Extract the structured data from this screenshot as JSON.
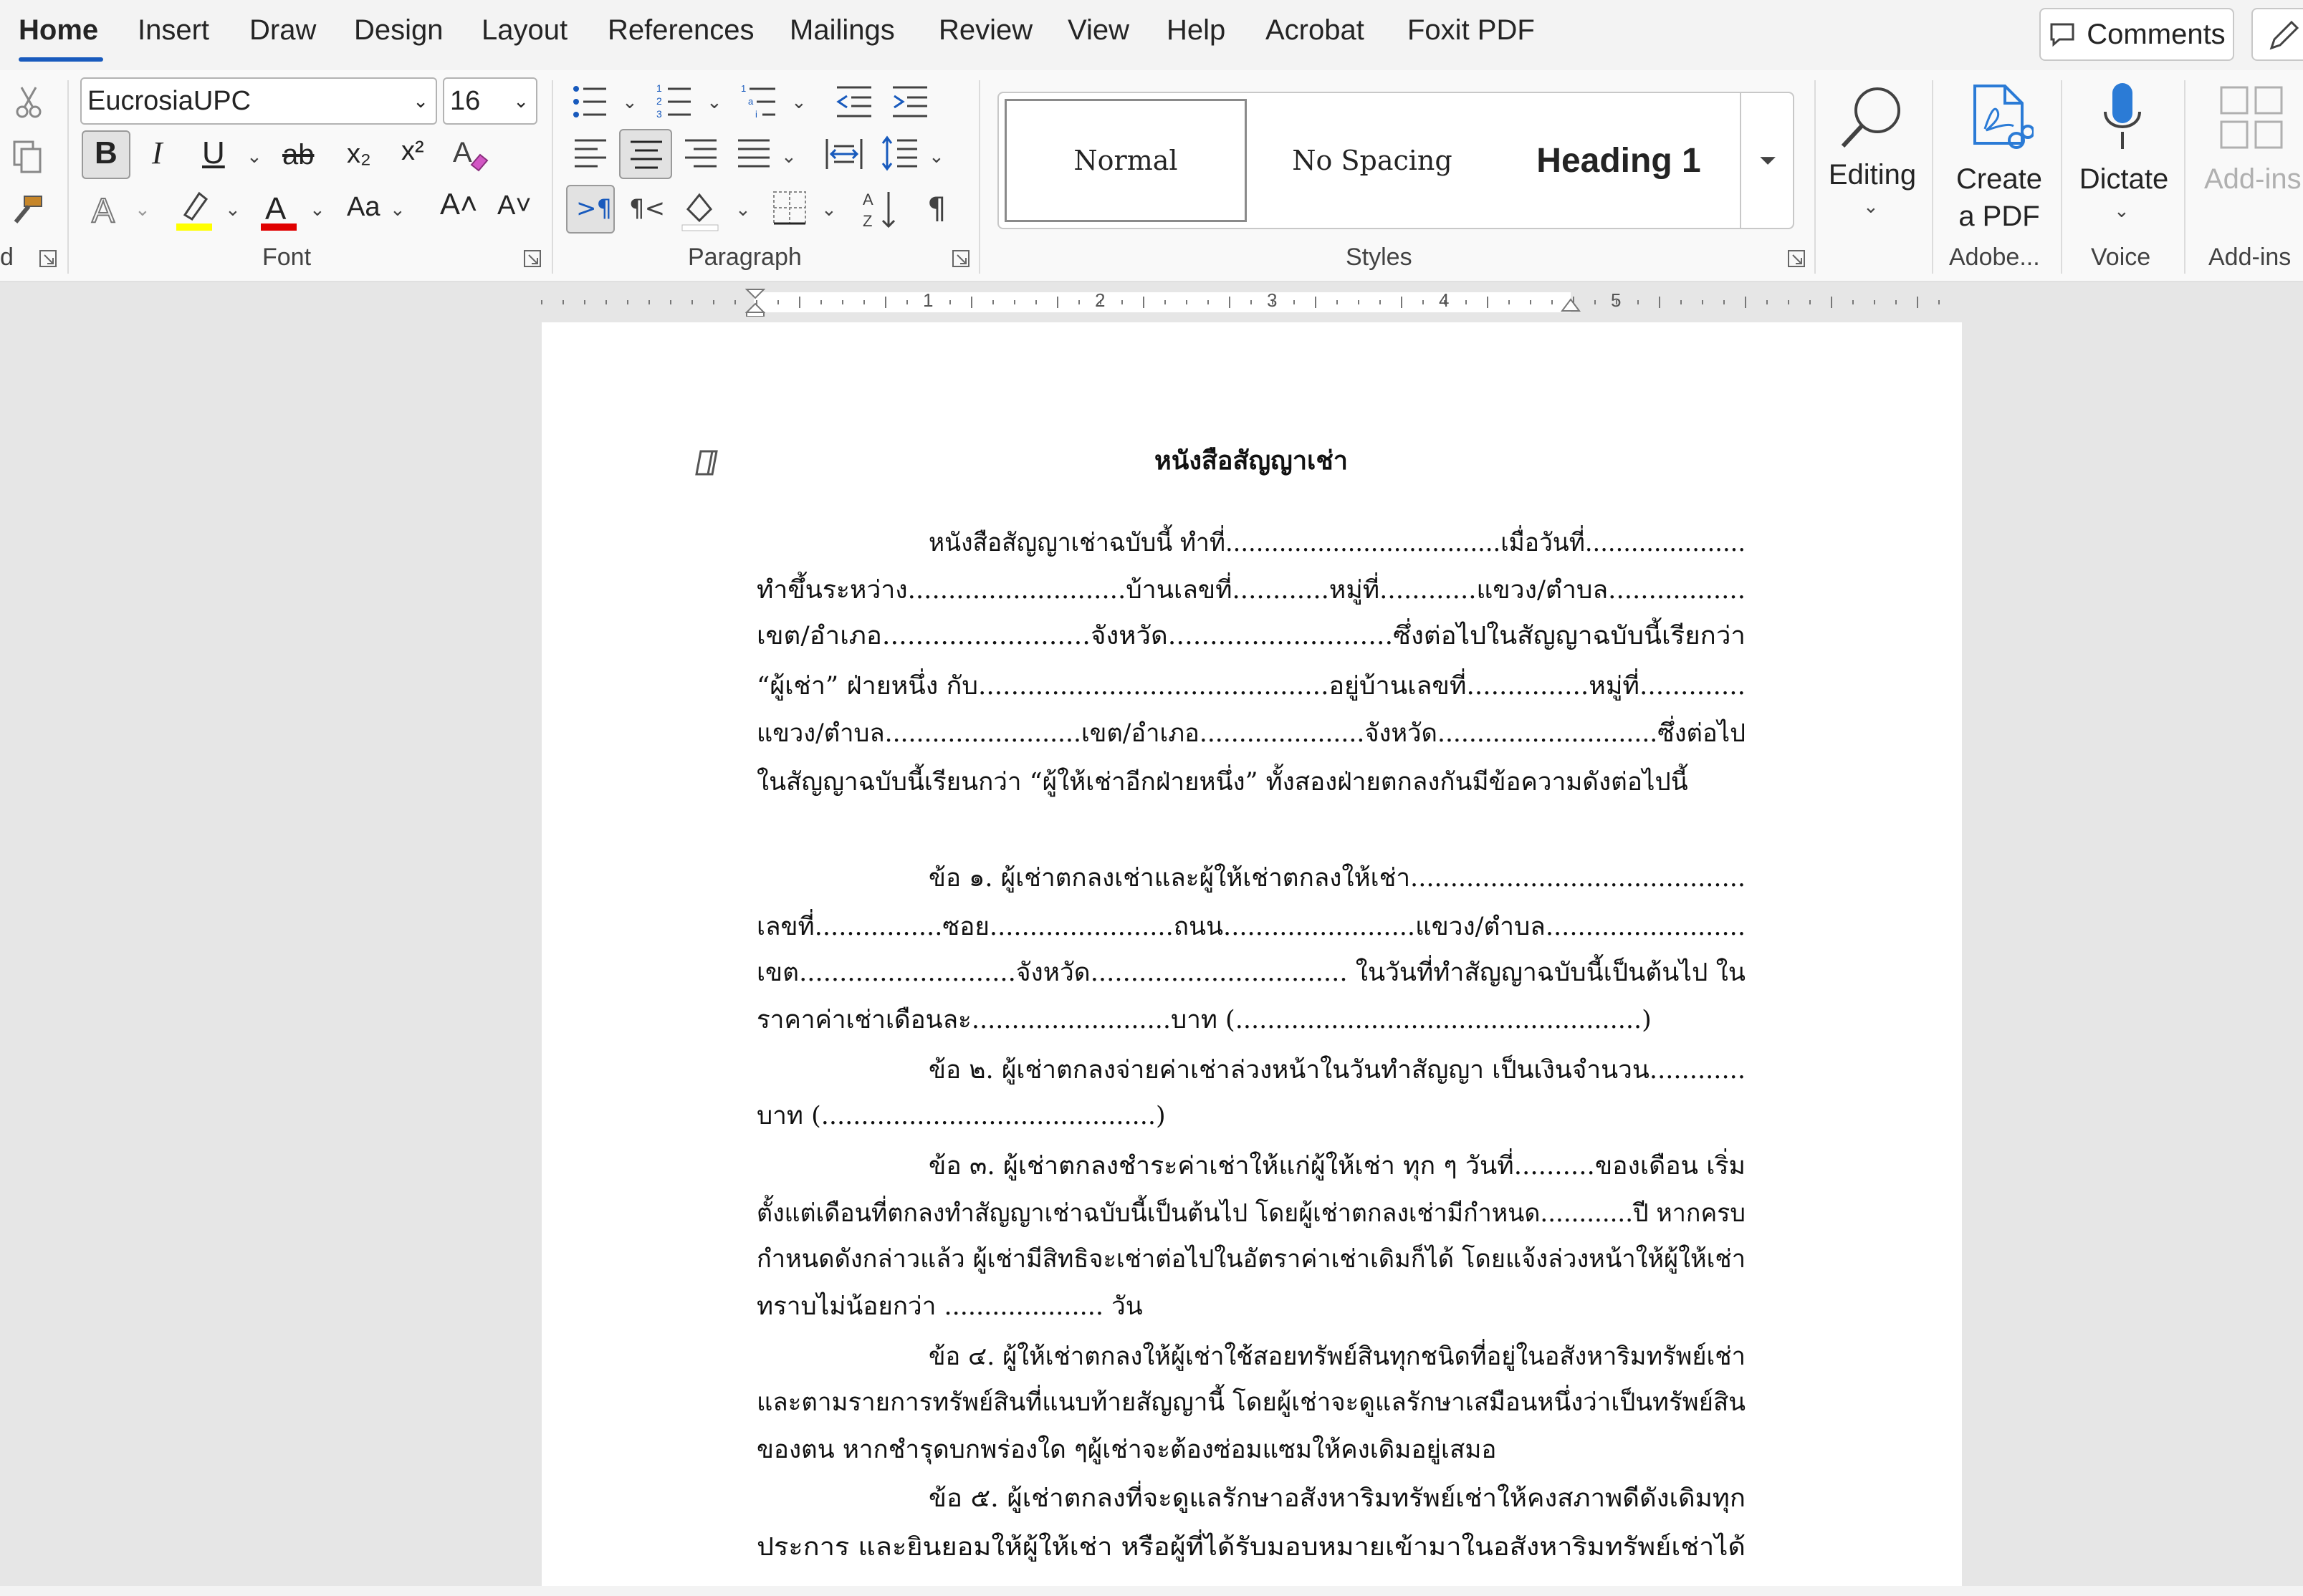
{
  "tabs": [
    "Home",
    "Insert",
    "Draw",
    "Design",
    "Layout",
    "References",
    "Mailings",
    "Review",
    "View",
    "Help",
    "Acrobat",
    "Foxit PDF"
  ],
  "active_tab": "Home",
  "comments_label": "Comments",
  "font": {
    "name": "EucrosiaUPC",
    "size": "16"
  },
  "groups": {
    "clipboard": "d",
    "font": "Font",
    "paragraph": "Paragraph",
    "styles": "Styles",
    "adobe": "Adobe...",
    "voice": "Voice",
    "addins": "Add-ins"
  },
  "styles": [
    "Normal",
    "No Spacing",
    "Heading 1"
  ],
  "buttons": {
    "editing": "Editing",
    "create_pdf_1": "Create",
    "create_pdf_2": "a PDF",
    "dictate": "Dictate",
    "addins": "Add-ins"
  },
  "format_glyphs": {
    "bold": "B",
    "italic": "I",
    "underline": "U",
    "strike": "ab",
    "subscript": "x₂",
    "superscript": "x²",
    "case": "Aa",
    "grow": "A˄",
    "shrink": "A˅"
  },
  "ruler_numbers": [
    "1",
    "2",
    "3",
    "4",
    "5"
  ],
  "colors": {
    "accent": "#185abd",
    "highlight": "#ffff00",
    "font_color": "#e00000",
    "dictate": "#2b7bd6"
  },
  "document": {
    "title": "หนังสือสัญญาเช่า",
    "lines": [
      "หนังสือสัญญาเช่าฉบับนี้ ทำที่....................................เมื่อวันที่.....................",
      "ทำขึ้นระหว่าง...........................บ้านเลขที่............หมู่ที่............แขวง/ตำบล.................",
      "เขต/อำเภอ.........................จังหวัด...........................ซึ่งต่อไปในสัญญาฉบับนี้เรียกว่า",
      "“ผู้เช่า” ฝ่ายหนึ่ง กับ...........................................อยู่บ้านเลขที่...............หมู่ที่.............",
      "แขวง/ตำบล.........................เขต/อำเภอ.....................จังหวัด............................ซึ่งต่อไป",
      "ในสัญญาฉบับนี้เรียนกว่า “ผู้ให้เช่าอีกฝ่ายหนึ่ง” ทั้งสองฝ่ายตกลงกันมีข้อความดังต่อไปนี้",
      "ข้อ ๑. ผู้เช่าตกลงเช่าและผู้ให้เช่าตกลงให้เช่า..........................................",
      "เลขที่................ซอย.......................ถนน........................แขวง/ตำบล.........................",
      "เขต...........................จังหวัด................................ ในวันที่ทำสัญญาฉบับนี้เป็นต้นไป ใน",
      "ราคาค่าเช่าเดือนละ.........................บาท (...................................................)",
      "ข้อ ๒. ผู้เช่าตกลงจ่ายค่าเช่าล่วงหน้าในวันทำสัญญา เป็นเงินจำนวน............",
      "บาท (..........................................)",
      "ข้อ ๓. ผู้เช่าตกลงชำระค่าเช่าให้แก่ผู้ให้เช่า ทุก ๆ วันที่..........ของเดือน เริ่ม",
      "ตั้งแต่เดือนที่ตกลงทำสัญญาเช่าฉบับนี้เป็นต้นไป โดยผู้เช่าตกลงเช่ามีกำหนด............ปี หากครบ",
      "กำหนดดังกล่าวแล้ว ผู้เช่ามีสิทธิจะเช่าต่อไปในอัตราค่าเช่าเดิมก็ได้  โดยแจ้งล่วงหน้าให้ผู้ให้เช่า",
      "ทราบไม่น้อยกว่า .................... วัน",
      "ข้อ ๔. ผู้ให้เช่าตกลงให้ผู้เช่าใช้สอยทรัพย์สินทุกชนิดที่อยู่ในอสังหาริมทรัพย์เช่า",
      "และตามรายการทรัพย์สินที่แนบท้ายสัญญานี้ โดยผู้เช่าจะดูแลรักษาเสมือนหนึ่งว่าเป็นทรัพย์สิน",
      "ของตน หากชำรุดบกพร่องใด ๆผู้เช่าจะต้องซ่อมแซมให้คงเดิมอยู่เสมอ",
      "ข้อ ๕. ผู้เช่าตกลงที่จะดูแลรักษาอสังหาริมทรัพย์เช่าให้คงสภาพดีดังเดิมทุก",
      "ประการ และยินยอมให้ผู้ให้เช่า หรือผู้ที่ได้รับมอบหมายเข้ามาในอสังหาริมทรัพย์เช่าได้"
    ]
  }
}
